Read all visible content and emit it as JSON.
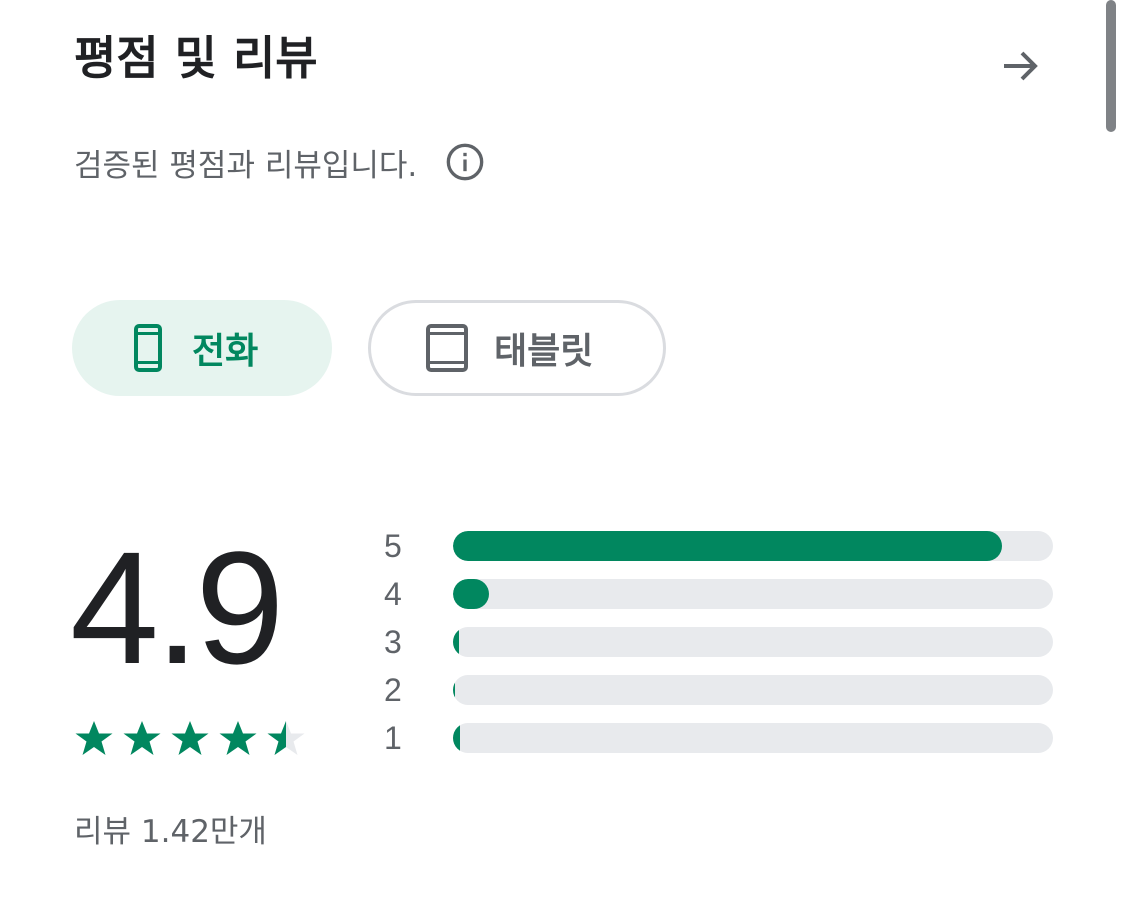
{
  "header": {
    "title": "평점 및 리뷰"
  },
  "subtitle": "검증된 평점과 리뷰입니다.",
  "device_filter": {
    "options": [
      {
        "label": "전화",
        "icon": "phone-icon",
        "selected": true
      },
      {
        "label": "태블릿",
        "icon": "tablet-icon",
        "selected": false
      }
    ]
  },
  "rating": {
    "score": "4.9",
    "stars": 4.5,
    "review_count": "리뷰 1.42만개"
  },
  "distribution": [
    {
      "label": "5",
      "fraction": 0.915
    },
    {
      "label": "4",
      "fraction": 0.06
    },
    {
      "label": "3",
      "fraction": 0.01
    },
    {
      "label": "2",
      "fraction": 0.003
    },
    {
      "label": "1",
      "fraction": 0.012
    }
  ],
  "colors": {
    "accent": "#01875f",
    "accent_light": "#e6f4ef",
    "track": "#e8eaed",
    "text_secondary": "#5f6368"
  }
}
